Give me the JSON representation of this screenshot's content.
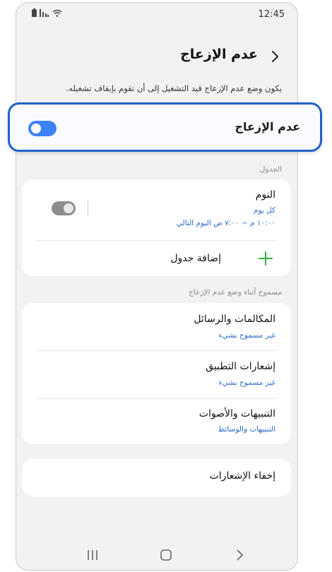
{
  "status": {
    "time": "12:45"
  },
  "header": {
    "title": "عدم الإزعاج"
  },
  "description": "يكون وضع عدم الإزعاج قيد التشغيل إلى أن تقوم بإيقاف تشغيله.",
  "main_toggle": {
    "label": "عدم الإزعاج",
    "on": true
  },
  "schedule": {
    "section_label": "الجدول",
    "sleep": {
      "title": "النوم",
      "days": "كل يوم",
      "time": "١٠:٠٠ م ~ ٧:٠٠ ص اليوم التالي",
      "on": false
    },
    "add_label": "إضافة جدول"
  },
  "allowed": {
    "section_label": "مسموح أثناء وضع عدم الإزعاج",
    "items": [
      {
        "title": "المكالمات والرسائل",
        "subtitle": "غير مسموح بشيء"
      },
      {
        "title": "إشعارات التطبيق",
        "subtitle": "غير مسموح بشيء"
      },
      {
        "title": "التنبيهات والأصوات",
        "subtitle": "التنبيهات والوسائط"
      }
    ]
  },
  "hide_notifications": {
    "title": "إخفاء الإشعارات"
  },
  "colors": {
    "accent": "#3e82f7",
    "highlight_border": "#1f63c7",
    "add_icon": "#2fae3a",
    "subtitle": "#2d6ccc"
  },
  "icons": [
    "battery-icon",
    "signal-icon",
    "wifi-icon",
    "back-chevron-icon",
    "plus-icon",
    "recents-icon",
    "home-icon",
    "back-icon"
  ]
}
